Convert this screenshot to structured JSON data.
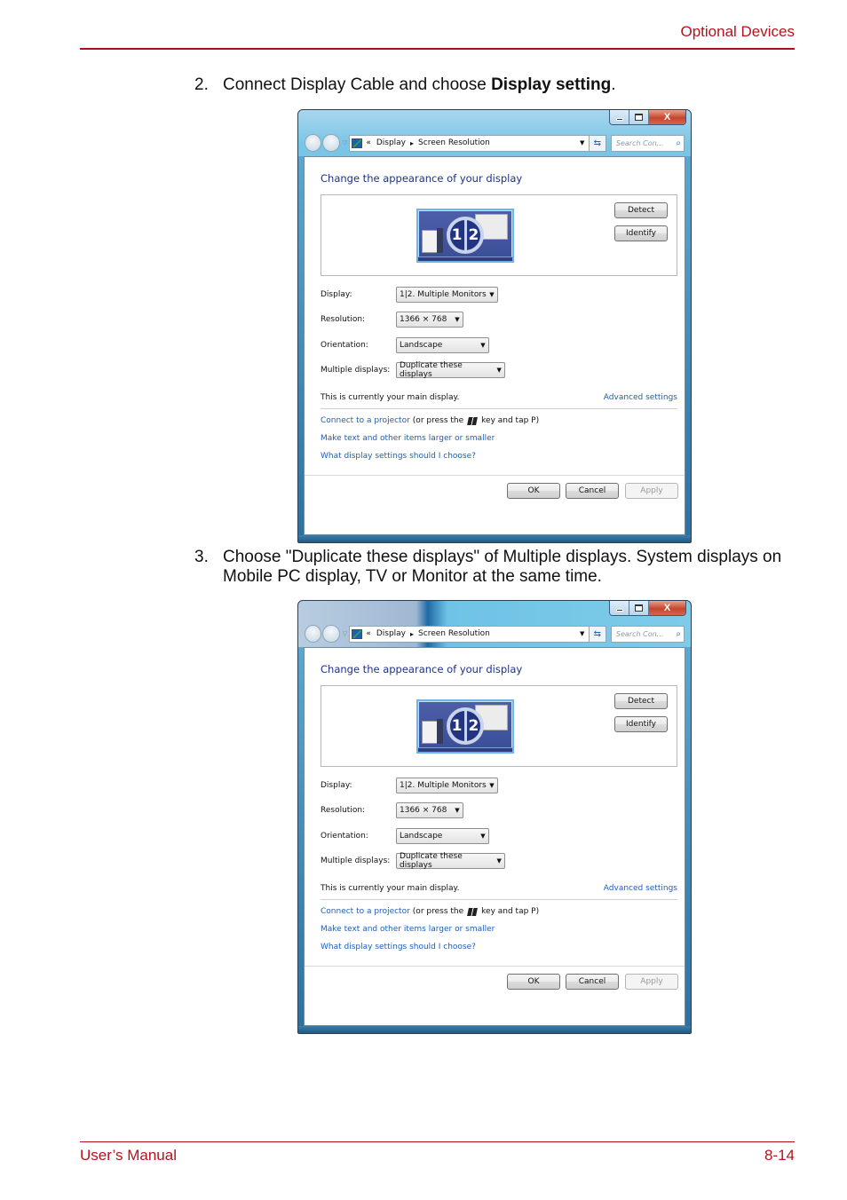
{
  "page": {
    "header": "Optional Devices",
    "footer_left": "User’s Manual",
    "footer_right": "8-14",
    "colors": {
      "accent": "#b5121b",
      "link": "#1f5fb3",
      "title": "#1e3287"
    }
  },
  "steps": [
    {
      "number": "2.",
      "text_before": "Connect Display Cable and choose ",
      "bold": "Display setting",
      "text_after": "."
    },
    {
      "number": "3.",
      "text": "Choose \"Duplicate these displays\" of Multiple displays. System displays on Mobile PC display, TV or Monitor at the same time."
    }
  ],
  "dialog": {
    "caption_buttons": {
      "minimize": "minimize-icon",
      "maximize": "maximize-icon",
      "close": "close-icon",
      "close_glyph": "X"
    },
    "nav": {
      "back": "back-icon",
      "forward": "forward-icon",
      "recent": "▽"
    },
    "breadcrumb": {
      "root_chevron": "«",
      "items": [
        "Display",
        "Screen Resolution"
      ],
      "separator": "▸",
      "dropdown": "▼"
    },
    "refresh_glyph": "⇆",
    "search_placeholder": "Search Con...",
    "search_glyph": "⌕",
    "heading": "Change the appearance of your display",
    "monitor_badge": [
      "1",
      "2"
    ],
    "buttons": {
      "detect": "Detect",
      "identify": "Identify",
      "ok": "OK",
      "cancel": "Cancel",
      "apply": "Apply"
    },
    "fields": [
      {
        "label": "Display:",
        "value": "1|2. Multiple Monitors"
      },
      {
        "label": "Resolution:",
        "value": "1366 × 768"
      },
      {
        "label": "Orientation:",
        "value": "Landscape"
      },
      {
        "label": "Multiple displays:",
        "value": "Duplicate these displays"
      }
    ],
    "combo_arrow": "▼",
    "main_note": "This is currently your main display.",
    "advanced_link": "Advanced settings",
    "projector_link": "Connect to a projector",
    "projector_text_before": "(or press the",
    "projector_text_after": "key and tap P)",
    "links": [
      "Make text and other items larger or smaller",
      "What display settings should I choose?"
    ]
  }
}
